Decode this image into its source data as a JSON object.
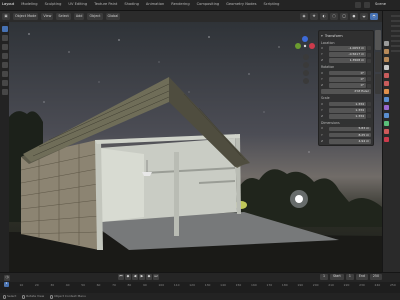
{
  "menubar": {
    "tabs": [
      "Layout",
      "Modeling",
      "Sculpting",
      "UV Editing",
      "Texture Paint",
      "Shading",
      "Animation",
      "Rendering",
      "Compositing",
      "Geometry Nodes",
      "Scripting"
    ],
    "active_tab": 0,
    "scene": "Scene"
  },
  "viewport_header": {
    "mode": "Object Mode",
    "view": "View",
    "select": "Select",
    "add": "Add",
    "object": "Object",
    "orientation": "Global"
  },
  "npanel": {
    "title": "Transform",
    "location_label": "Location",
    "location": [
      "-1.0053 m",
      "-0.5617 m",
      "1.3508 m"
    ],
    "rotation_label": "Rotation",
    "rotation": [
      "0°",
      "0°",
      "0°"
    ],
    "mode_label": "XYZ Euler",
    "scale_label": "Scale",
    "scale": [
      "1.334",
      "1.334",
      "1.334"
    ],
    "dimensions_label": "Dimensions",
    "dimensions": [
      "5.83 m",
      "8.25 m",
      "4.94 m"
    ],
    "axes": [
      "X",
      "Y",
      "Z"
    ]
  },
  "timeline": {
    "current_frame": "1",
    "start_label": "Start",
    "start": "1",
    "end_label": "End",
    "end": "250",
    "ruler_ticks": [
      "0",
      "10",
      "20",
      "30",
      "40",
      "50",
      "60",
      "70",
      "80",
      "90",
      "100",
      "110",
      "120",
      "130",
      "140",
      "150",
      "160",
      "170",
      "180",
      "190",
      "200",
      "210",
      "220",
      "230",
      "240",
      "250"
    ]
  },
  "statusbar": {
    "select": "Select",
    "rotate": "Rotate View",
    "context": "Object Context Menu"
  },
  "colors": {
    "accent": "#4772b3",
    "panel": "#303030",
    "background": "#1d1d1d"
  }
}
